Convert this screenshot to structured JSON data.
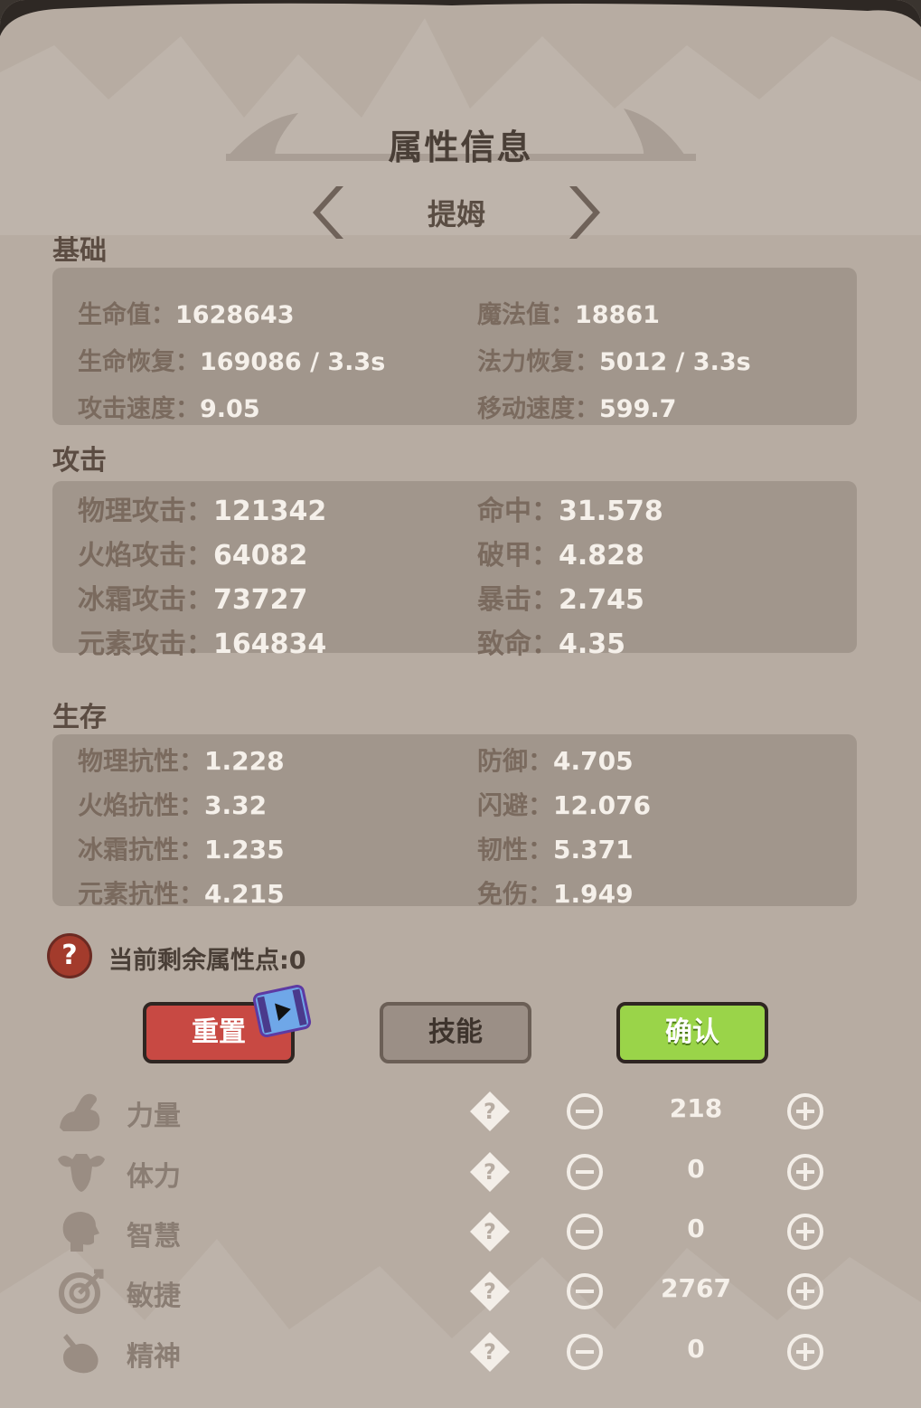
{
  "title": "属性信息",
  "hero": {
    "name": "提姆",
    "prev_icon": "chevron-left-icon",
    "next_icon": "chevron-right-icon"
  },
  "basic": {
    "label": "基础",
    "stats": [
      {
        "key": "生命值：",
        "value": "1628643"
      },
      {
        "key": "魔法值：",
        "value": "18861"
      },
      {
        "key": "生命恢复：",
        "value": "169086 / 3.3s"
      },
      {
        "key": "法力恢复：",
        "value": "5012 / 3.3s"
      },
      {
        "key": "攻击速度：",
        "value": "9.05"
      },
      {
        "key": "移动速度：",
        "value": "599.7"
      }
    ]
  },
  "attack": {
    "label": "攻击",
    "stats": [
      {
        "key": "物理攻击：",
        "value": "121342"
      },
      {
        "key": "命中：",
        "value": "31.578"
      },
      {
        "key": "火焰攻击：",
        "value": "64082"
      },
      {
        "key": "破甲：",
        "value": "4.828"
      },
      {
        "key": "冰霜攻击：",
        "value": "73727"
      },
      {
        "key": "暴击：",
        "value": "2.745"
      },
      {
        "key": "元素攻击：",
        "value": "164834"
      },
      {
        "key": "致命：",
        "value": "4.35"
      }
    ]
  },
  "survival": {
    "label": "生存",
    "stats": [
      {
        "key": "物理抗性：",
        "value": "1.228"
      },
      {
        "key": "防御：",
        "value": "4.705"
      },
      {
        "key": "火焰抗性：",
        "value": "3.32"
      },
      {
        "key": "闪避：",
        "value": "12.076"
      },
      {
        "key": "冰霜抗性：",
        "value": "1.235"
      },
      {
        "key": "韧性：",
        "value": "5.371"
      },
      {
        "key": "元素抗性：",
        "value": "4.215"
      },
      {
        "key": "免伤：",
        "value": "1.949"
      }
    ]
  },
  "points": {
    "help_glyph": "?",
    "text": "当前剩余属性点:0"
  },
  "buttons": {
    "reset": "重置",
    "skill": "技能",
    "confirm": "确认"
  },
  "attributes": [
    {
      "name": "力量",
      "value": "218",
      "icon": "arm-icon"
    },
    {
      "name": "体力",
      "value": "0",
      "icon": "torso-icon"
    },
    {
      "name": "智慧",
      "value": "0",
      "icon": "head-icon"
    },
    {
      "name": "敏捷",
      "value": "2767",
      "icon": "target-icon"
    },
    {
      "name": "精神",
      "value": "0",
      "icon": "spirit-icon"
    }
  ],
  "colors": {
    "panel": "#b7aca2",
    "box": "#a1968c",
    "reset": "#c84943",
    "confirm": "#9ad449"
  }
}
